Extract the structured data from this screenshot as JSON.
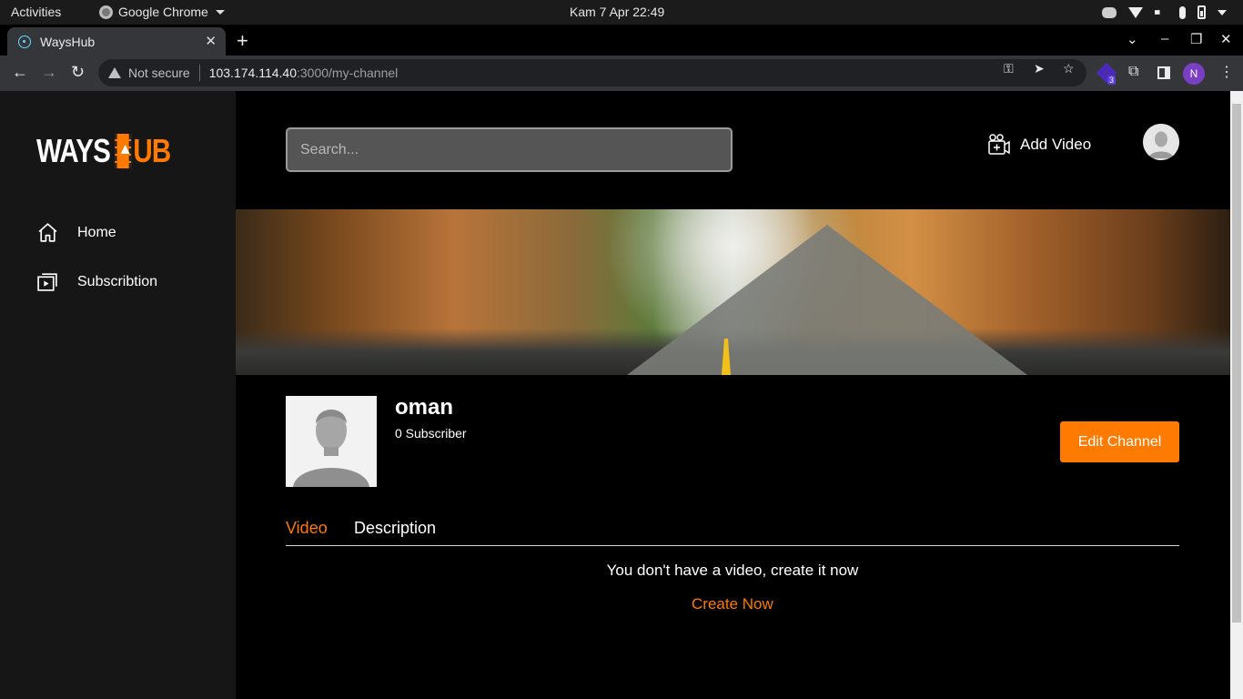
{
  "system": {
    "activities": "Activities",
    "app_name": "Google Chrome",
    "clock": "Kam  7 Apr  22:49"
  },
  "browser": {
    "tab_title": "WaysHub",
    "security_label": "Not secure",
    "url_host": "103.174.114.40",
    "url_path": ":3000/my-channel",
    "extension_badge": "3",
    "profile_initial": "N"
  },
  "sidebar": {
    "logo_left": "WAYS",
    "logo_right": "UB",
    "items": [
      {
        "label": "Home",
        "icon": "home-icon"
      },
      {
        "label": "Subscribtion",
        "icon": "subscription-icon"
      }
    ]
  },
  "header": {
    "search_placeholder": "Search...",
    "add_video_label": "Add Video"
  },
  "channel": {
    "name": "oman",
    "subscribers": "0 Subscriber",
    "edit_label": "Edit Channel"
  },
  "tabs": {
    "video": "Video",
    "description": "Description"
  },
  "empty_state": {
    "message": "You don't have a video, create it now",
    "cta": "Create Now"
  },
  "colors": {
    "accent": "#ff7a00",
    "sidebar_bg": "#161616",
    "page_bg": "#000000"
  }
}
